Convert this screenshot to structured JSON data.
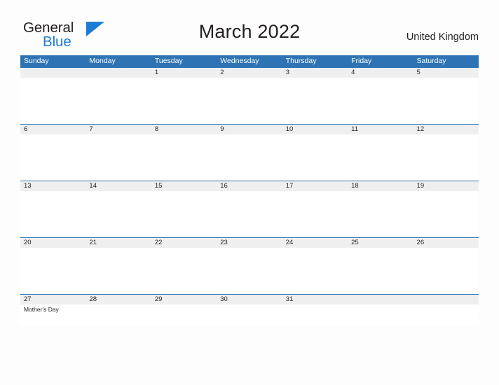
{
  "brand": {
    "name_part1": "General",
    "name_part2": "Blue",
    "flag_icon": "flag-triangle-icon",
    "accent_color": "#1c7cd6"
  },
  "header": {
    "title": "March 2022",
    "country": "United Kingdom"
  },
  "theme": {
    "header_blue": "#2e74b5",
    "band_gray": "#efefef",
    "page_background": "#fdfdfd",
    "text_color": "#231f20"
  },
  "calendar": {
    "month": "March",
    "year": "2022",
    "weekdays": [
      "Sunday",
      "Monday",
      "Tuesday",
      "Wednesday",
      "Thursday",
      "Friday",
      "Saturday"
    ],
    "weeks": [
      {
        "days": [
          {
            "date": "",
            "events": []
          },
          {
            "date": "",
            "events": []
          },
          {
            "date": "1",
            "events": []
          },
          {
            "date": "2",
            "events": []
          },
          {
            "date": "3",
            "events": []
          },
          {
            "date": "4",
            "events": []
          },
          {
            "date": "5",
            "events": []
          }
        ]
      },
      {
        "days": [
          {
            "date": "6",
            "events": []
          },
          {
            "date": "7",
            "events": []
          },
          {
            "date": "8",
            "events": []
          },
          {
            "date": "9",
            "events": []
          },
          {
            "date": "10",
            "events": []
          },
          {
            "date": "11",
            "events": []
          },
          {
            "date": "12",
            "events": []
          }
        ]
      },
      {
        "days": [
          {
            "date": "13",
            "events": []
          },
          {
            "date": "14",
            "events": []
          },
          {
            "date": "15",
            "events": []
          },
          {
            "date": "16",
            "events": []
          },
          {
            "date": "17",
            "events": []
          },
          {
            "date": "18",
            "events": []
          },
          {
            "date": "19",
            "events": []
          }
        ]
      },
      {
        "days": [
          {
            "date": "20",
            "events": []
          },
          {
            "date": "21",
            "events": []
          },
          {
            "date": "22",
            "events": []
          },
          {
            "date": "23",
            "events": []
          },
          {
            "date": "24",
            "events": []
          },
          {
            "date": "25",
            "events": []
          },
          {
            "date": "26",
            "events": []
          }
        ]
      },
      {
        "days": [
          {
            "date": "27",
            "events": [
              "Mother's Day"
            ]
          },
          {
            "date": "28",
            "events": []
          },
          {
            "date": "29",
            "events": []
          },
          {
            "date": "30",
            "events": []
          },
          {
            "date": "31",
            "events": []
          },
          {
            "date": "",
            "events": []
          },
          {
            "date": "",
            "events": []
          }
        ]
      }
    ]
  }
}
